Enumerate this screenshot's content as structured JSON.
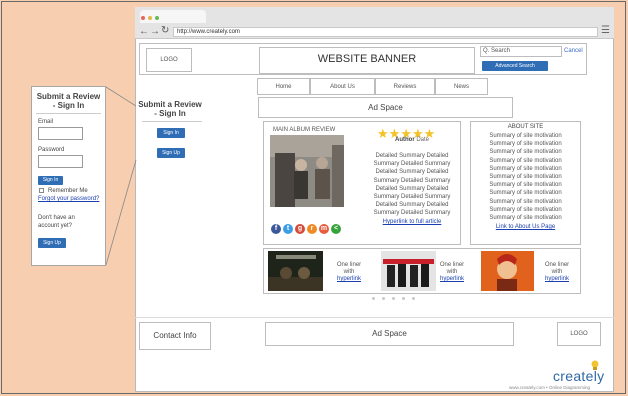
{
  "browser": {
    "url": "http://www.creately.com"
  },
  "header": {
    "logo": "LOGO",
    "banner": "WEBSITE BANNER",
    "search_placeholder": "Q. Search",
    "cancel": "Cancel",
    "advanced_search": "Advanced Search"
  },
  "nav": {
    "items": [
      "Home",
      "About Us",
      "Reviews",
      "News"
    ]
  },
  "ad_top": "Ad Space",
  "left_column": {
    "title_line1": "Submit a Review",
    "title_line2": "- Sign In",
    "sign_in": "Sign In",
    "sign_up": "Sign Up"
  },
  "popout": {
    "title_line1": "Submit a Review",
    "title_line2": "- Sign In",
    "email_label": "Email",
    "password_label": "Password",
    "sign_in": "Sign In",
    "remember_me": "Remember Me",
    "forgot": "Forgot your password?",
    "no_account_line1": "Don't have an",
    "no_account_line2": "account yet?",
    "sign_up": "Sign Up"
  },
  "album": {
    "heading": "MAIN ALBUM REVIEW",
    "rating": 5,
    "author": "Author",
    "date": "Date",
    "summary_lines": [
      "Detailed Summary Detailed",
      "Summary Detailed Summary",
      "Detailed Summary Detailed",
      "Summary Detailed Summary",
      "Detailed Summary Detailed",
      "Summary Detailed Summary",
      "Detailed Summary Detailed",
      "Summary Detailed Summary"
    ],
    "link": "Hyperlink to full article"
  },
  "about": {
    "heading": "ABOUT SITE",
    "lines": [
      "Summary of site motivation",
      "Summary of site motivation",
      "Summary of site motivation",
      "Summary of site motivation",
      "Summary of site motivation",
      "Summary of site motivation",
      "Summary of site motivation",
      "Summary of site motivation",
      "Summary of site motivation",
      "Summary of site motivation",
      "Summary of site motivation"
    ],
    "link": "Link to About Us Page"
  },
  "social_icons": [
    {
      "name": "facebook-icon",
      "glyph": "f",
      "color": "#3b5998"
    },
    {
      "name": "twitter-icon",
      "glyph": "t",
      "color": "#3d9ee6"
    },
    {
      "name": "google-plus-icon",
      "glyph": "g",
      "color": "#d44a3a"
    },
    {
      "name": "rss-icon",
      "glyph": "r",
      "color": "#f08a24"
    },
    {
      "name": "email-icon",
      "glyph": "m",
      "color": "#e55c3f"
    },
    {
      "name": "share-icon",
      "glyph": "<",
      "color": "#37a33c"
    }
  ],
  "carousel": {
    "items": [
      {
        "line1": "One liner",
        "line2": "with",
        "link": "hyperlink"
      },
      {
        "line1": "One liner",
        "line2": "with",
        "link": "hyperlink"
      },
      {
        "line1": "One liner",
        "line2": "with",
        "link": "hyperlink"
      }
    ],
    "pages": 5
  },
  "footer": {
    "contact": "Contact Info",
    "ad": "Ad Space",
    "logo": "LOGO"
  },
  "watermark": {
    "brand": "creately",
    "tagline": "www.creately.com • Online Diagramming"
  }
}
